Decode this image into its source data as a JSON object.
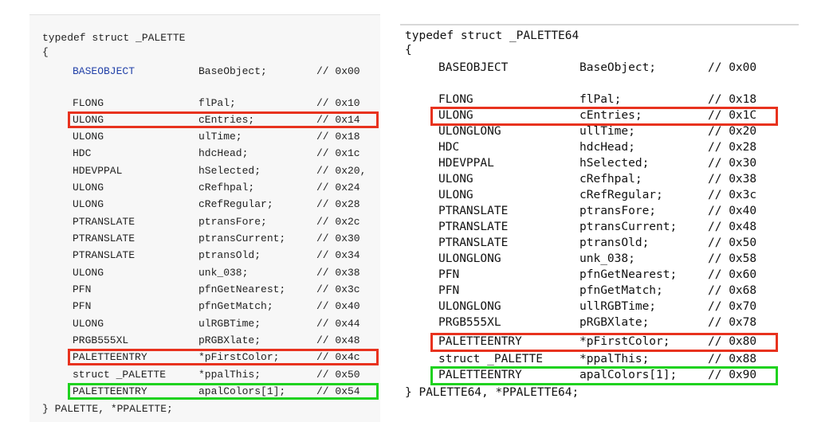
{
  "left": {
    "header": "typedef struct _PALETTE",
    "open_brace": "{",
    "fields": [
      {
        "type": "BASEOBJECT",
        "name": "BaseObject;",
        "offset": "// 0x00"
      },
      {
        "type": "FLONG",
        "name": "flPal;",
        "offset": "// 0x10"
      },
      {
        "type": "ULONG",
        "name": "cEntries;",
        "offset": "// 0x14"
      },
      {
        "type": "ULONG",
        "name": "ulTime;",
        "offset": "// 0x18"
      },
      {
        "type": "HDC",
        "name": "hdcHead;",
        "offset": "// 0x1c"
      },
      {
        "type": "HDEVPPAL",
        "name": "hSelected;",
        "offset": "// 0x20,"
      },
      {
        "type": "ULONG",
        "name": "cRefhpal;",
        "offset": "// 0x24"
      },
      {
        "type": "ULONG",
        "name": "cRefRegular;",
        "offset": "// 0x28"
      },
      {
        "type": "PTRANSLATE",
        "name": "ptransFore;",
        "offset": "// 0x2c"
      },
      {
        "type": "PTRANSLATE",
        "name": "ptransCurrent;",
        "offset": "// 0x30"
      },
      {
        "type": "PTRANSLATE",
        "name": "ptransOld;",
        "offset": "// 0x34"
      },
      {
        "type": "ULONG",
        "name": "unk_038;",
        "offset": "// 0x38"
      },
      {
        "type": "PFN",
        "name": "pfnGetNearest;",
        "offset": "// 0x3c"
      },
      {
        "type": "PFN",
        "name": "pfnGetMatch;",
        "offset": "// 0x40"
      },
      {
        "type": "ULONG",
        "name": "ulRGBTime;",
        "offset": "// 0x44"
      },
      {
        "type": "PRGB555XL",
        "name": "pRGBXlate;",
        "offset": "// 0x48"
      },
      {
        "type": "PALETTEENTRY",
        "name": "*pFirstColor;",
        "offset": "// 0x4c"
      },
      {
        "type": "struct _PALETTE",
        "name": "*ppalThis;",
        "offset": "// 0x50"
      },
      {
        "type": "PALETTEENTRY",
        "name": "apalColors[1];",
        "offset": "// 0x54"
      }
    ],
    "footer": "} PALETTE, *PPALETTE;"
  },
  "right": {
    "header": "typedef struct _PALETTE64",
    "open_brace": "{",
    "fields": [
      {
        "type": "BASEOBJECT",
        "name": "BaseObject;",
        "offset": "// 0x00"
      },
      {
        "type": "FLONG",
        "name": "flPal;",
        "offset": "// 0x18"
      },
      {
        "type": "ULONG",
        "name": "cEntries;",
        "offset": "// 0x1C"
      },
      {
        "type": "ULONGLONG",
        "name": "ullTime;",
        "offset": "// 0x20"
      },
      {
        "type": "HDC",
        "name": "hdcHead;",
        "offset": "// 0x28"
      },
      {
        "type": "HDEVPPAL",
        "name": "hSelected;",
        "offset": "// 0x30"
      },
      {
        "type": "ULONG",
        "name": "cRefhpal;",
        "offset": "// 0x38"
      },
      {
        "type": "ULONG",
        "name": "cRefRegular;",
        "offset": "// 0x3c"
      },
      {
        "type": "PTRANSLATE",
        "name": "ptransFore;",
        "offset": "// 0x40"
      },
      {
        "type": "PTRANSLATE",
        "name": "ptransCurrent;",
        "offset": "// 0x48"
      },
      {
        "type": "PTRANSLATE",
        "name": "ptransOld;",
        "offset": "// 0x50"
      },
      {
        "type": "ULONGLONG",
        "name": "unk_038;",
        "offset": "// 0x58"
      },
      {
        "type": "PFN",
        "name": "pfnGetNearest;",
        "offset": "// 0x60"
      },
      {
        "type": "PFN",
        "name": "pfnGetMatch;",
        "offset": "// 0x68"
      },
      {
        "type": "ULONGLONG",
        "name": "ullRGBTime;",
        "offset": "// 0x70"
      },
      {
        "type": "PRGB555XL",
        "name": "pRGBXlate;",
        "offset": "// 0x78"
      },
      {
        "type": "PALETTEENTRY",
        "name": "*pFirstColor;",
        "offset": "// 0x80"
      },
      {
        "type": "struct _PALETTE",
        "name": "*ppalThis;",
        "offset": "// 0x88"
      },
      {
        "type": "PALETTEENTRY",
        "name": "apalColors[1];",
        "offset": "// 0x90"
      }
    ],
    "footer": "} PALETTE64, *PPALETTE64;"
  },
  "highlight_colors": {
    "red": "#e8321e",
    "green": "#1fd21f"
  }
}
